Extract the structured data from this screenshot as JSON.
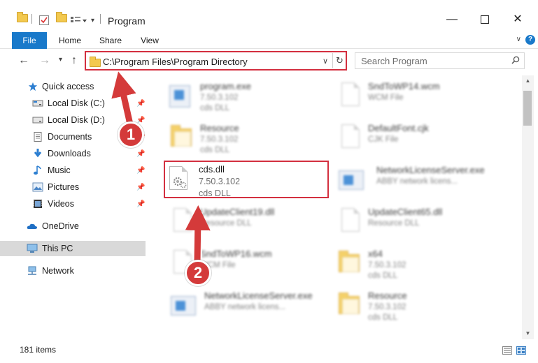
{
  "window": {
    "title": "Program"
  },
  "ribbon": {
    "tabs": [
      "File",
      "Home",
      "Share",
      "View"
    ]
  },
  "address": {
    "path": "C:\\Program Files\\Program Directory"
  },
  "search": {
    "placeholder": "Search Program"
  },
  "sidebar": {
    "items": [
      {
        "label": "Quick access",
        "icon": "star-icon",
        "pinned": false
      },
      {
        "label": "Local Disk (C:)",
        "icon": "drive-icon",
        "pinned": true
      },
      {
        "label": "Local Disk (D:)",
        "icon": "drive-icon",
        "pinned": true
      },
      {
        "label": "Documents",
        "icon": "documents-icon",
        "pinned": true
      },
      {
        "label": "Downloads",
        "icon": "download-icon",
        "pinned": true
      },
      {
        "label": "Music",
        "icon": "music-icon",
        "pinned": true
      },
      {
        "label": "Pictures",
        "icon": "pictures-icon",
        "pinned": true
      },
      {
        "label": "Videos",
        "icon": "videos-icon",
        "pinned": true
      },
      {
        "label": "OneDrive",
        "icon": "cloud-icon",
        "pinned": false
      },
      {
        "label": "This PC",
        "icon": "computer-icon",
        "pinned": false,
        "selected": true
      },
      {
        "label": "Network",
        "icon": "network-icon",
        "pinned": false
      }
    ]
  },
  "files": [
    {
      "name": "program.exe",
      "line1": "7.50.3.102",
      "line2": "cds DLL",
      "icon": "app-icon"
    },
    {
      "name": "SndToWP14.wcm",
      "line1": "WCM File",
      "line2": "",
      "icon": "file-icon"
    },
    {
      "name": "Resource",
      "line1": "7.50.3.102",
      "line2": "cds DLL",
      "icon": "folder-icon"
    },
    {
      "name": "DefaultFont.cjk",
      "line1": "CJK File",
      "line2": "",
      "icon": "file-icon"
    },
    {
      "name": "cds.dll",
      "line1": "7.50.3.102",
      "line2": "cds DLL",
      "icon": "dll-gear-icon"
    },
    {
      "name": "NetworkLicenseServer.exe",
      "line1": "ABBY network licens...",
      "line2": "",
      "icon": "app-icon"
    },
    {
      "name": "UpdateClient19.dll",
      "line1": "Resource DLL",
      "line2": "",
      "icon": "dll-gear-icon"
    },
    {
      "name": "UpdateClient65.dll",
      "line1": "Resource DLL",
      "line2": "",
      "icon": "dll-gear-icon"
    },
    {
      "name": "SndToWP16.wcm",
      "line1": "WCM File",
      "line2": "",
      "icon": "file-icon"
    },
    {
      "name": "x64",
      "line1": "7.50.3.102",
      "line2": "cds DLL",
      "icon": "folder-icon"
    },
    {
      "name": "NetworkLicenseServer.exe",
      "line1": "ABBY network licens...",
      "line2": "",
      "icon": "app-icon"
    },
    {
      "name": "Resource",
      "line1": "7.50.3.102",
      "line2": "cds DLL",
      "icon": "folder-icon"
    }
  ],
  "status": {
    "item_count": "181 items"
  },
  "callouts": {
    "one": "1",
    "two": "2"
  },
  "colors": {
    "accent": "#1979ca",
    "highlight": "#d32f3f",
    "callout": "#d43a3a"
  }
}
